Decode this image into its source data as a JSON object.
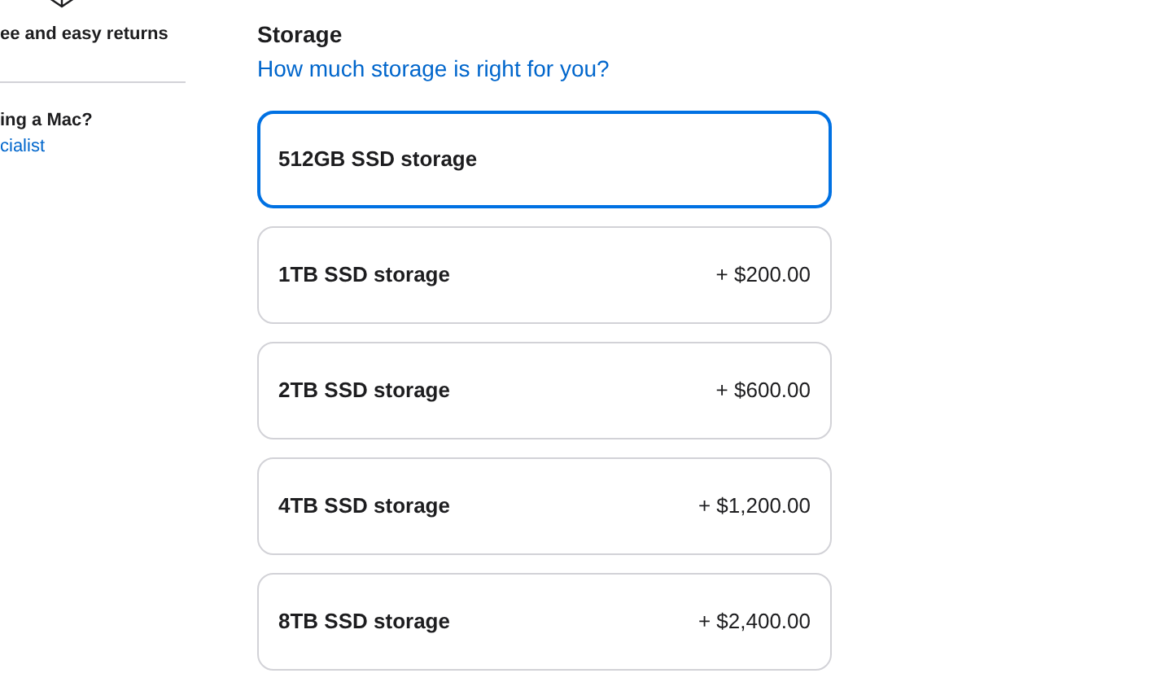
{
  "sidebar": {
    "returns_text": "ee and easy returns",
    "help_question": "ing a Mac?",
    "help_link": "cialist"
  },
  "storage": {
    "heading": "Storage",
    "help_link": "How much storage is right for you?",
    "options": [
      {
        "label": "512GB SSD storage",
        "selected": true
      },
      {
        "label": "1TB SSD storage",
        "price": "+ $200.00",
        "selected": false
      },
      {
        "label": "2TB SSD storage",
        "price": "+ $600.00",
        "selected": false
      },
      {
        "label": "4TB SSD storage",
        "price": "+ $1,200.00",
        "selected": false
      },
      {
        "label": "8TB SSD storage",
        "price": "+ $2,400.00",
        "selected": false
      }
    ]
  }
}
